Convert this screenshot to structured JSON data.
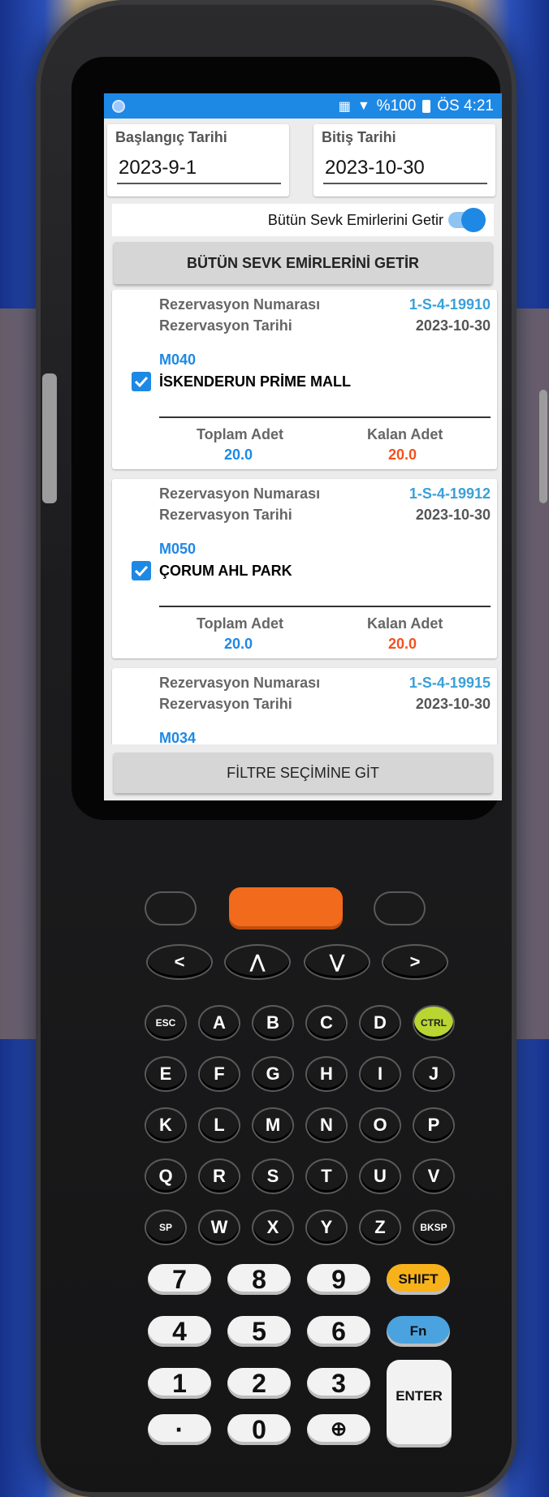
{
  "status_bar": {
    "battery": "%100",
    "time": "ÖS 4:21"
  },
  "start_date": {
    "label": "Başlangıç Tarihi",
    "value": "2023-9-1"
  },
  "end_date": {
    "label": "Bitiş Tarihi",
    "value": "2023-10-30"
  },
  "toggle": {
    "label": "Bütün Sevk Emirlerini Getir",
    "on": true
  },
  "fetch_button": "BÜTÜN SEVK EMİRLERİNİ GETİR",
  "filter_button": "FİLTRE SEÇİMİNE GİT",
  "labels": {
    "reservation_no": "Rezervasyon Numarası",
    "reservation_date": "Rezervasyon Tarihi",
    "total_qty": "Toplam Adet",
    "remaining_qty": "Kalan Adet"
  },
  "orders": [
    {
      "reservation_no": "1-S-4-19910",
      "reservation_date": "2023-10-30",
      "code": "M040",
      "store": "İSKENDERUN PRİME MALL",
      "checked": true,
      "total": "20.0",
      "remaining": "20.0"
    },
    {
      "reservation_no": "1-S-4-19912",
      "reservation_date": "2023-10-30",
      "code": "M050",
      "store": "ÇORUM AHL PARK",
      "checked": true,
      "total": "20.0",
      "remaining": "20.0"
    },
    {
      "reservation_no": "1-S-4-19915",
      "reservation_date": "2023-10-30",
      "code": "M034",
      "store": "",
      "checked": true,
      "total": "",
      "remaining": ""
    }
  ],
  "colors": {
    "accent": "#1e88e5",
    "reservation_no": "#3aa0d8",
    "remaining": "#f4511e"
  },
  "keypad": {
    "row_nav": [
      "<",
      "⋀",
      "⋁",
      ">"
    ],
    "row1": [
      "ESC",
      "A",
      "B",
      "C",
      "D",
      "CTRL"
    ],
    "row2": [
      "E",
      "F",
      "G",
      "H",
      "I",
      "J"
    ],
    "row3": [
      "K",
      "L",
      "M",
      "N",
      "O",
      "P"
    ],
    "row4": [
      "Q",
      "R",
      "S",
      "T",
      "U",
      "V"
    ],
    "row5": [
      "SP",
      "W",
      "X",
      "Y",
      "Z",
      "BKSP"
    ],
    "num1": [
      "7",
      "8",
      "9",
      "SHIFT"
    ],
    "num2": [
      "4",
      "5",
      "6",
      "Fn"
    ],
    "num3": [
      "1",
      "2",
      "3"
    ],
    "num4": [
      "·",
      "0",
      "⊕"
    ],
    "enter": "ENTER"
  }
}
